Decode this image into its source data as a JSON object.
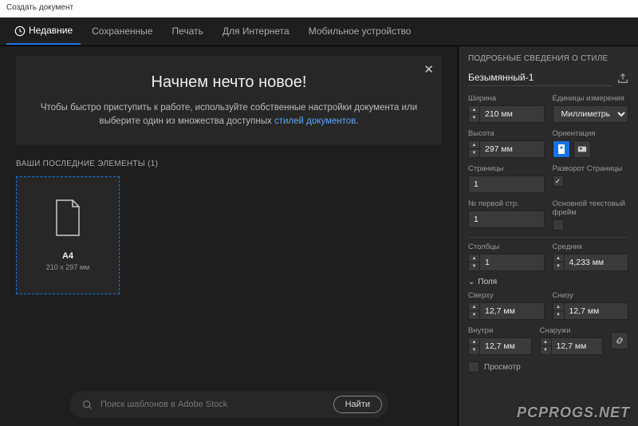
{
  "window_title": "Создать документ",
  "tabs": {
    "recent": "Недавние",
    "saved": "Сохраненные",
    "print": "Печать",
    "web": "Для Интернета",
    "mobile": "Мобильное устройство"
  },
  "welcome": {
    "title": "Начнем нечто новое!",
    "body_a": "Чтобы быстро приступить к работе, используйте собственные настройки документа или выберите один из множества доступных ",
    "body_link": "стилей документов",
    "body_b": "."
  },
  "recent_section": {
    "label": "ВАШИ ПОСЛЕДНИЕ ЭЛЕМЕНТЫ  (1)",
    "card": {
      "title": "A4",
      "sub": "210 x 297 мм"
    }
  },
  "search": {
    "placeholder": "Поиск шаблонов в Adobe Stock",
    "button": "Найти"
  },
  "details": {
    "header": "ПОДРОБНЫЕ СВЕДЕНИЯ О СТИЛЕ",
    "name": "Безымянный-1",
    "width_lbl": "Ширина",
    "width_val": "210 мм",
    "units_lbl": "Единицы измерения",
    "units_val": "Миллиметры",
    "height_lbl": "Высота",
    "height_val": "297 мм",
    "orient_lbl": "Ориентация",
    "pages_lbl": "Страницы",
    "pages_val": "1",
    "facing_lbl": "Разворот Страницы",
    "facing_checked": "✓",
    "startpg_lbl": "№ первой стр.",
    "startpg_val": "1",
    "frame_lbl": "Основной текстовый фрейм",
    "cols_lbl": "Столбцы",
    "cols_val": "1",
    "gutter_lbl": "Средник",
    "gutter_val": "4,233 мм",
    "margins_hdr": "Поля",
    "top_lbl": "Сверху",
    "top_val": "12,7 мм",
    "bottom_lbl": "Снизу",
    "bottom_val": "12,7 мм",
    "inside_lbl": "Внутри",
    "inside_val": "12,7 мм",
    "outside_lbl": "Снаружи",
    "outside_val": "12,7 мм",
    "preview_lbl": "Просмотр"
  },
  "watermark": "PCPROGS.NET"
}
